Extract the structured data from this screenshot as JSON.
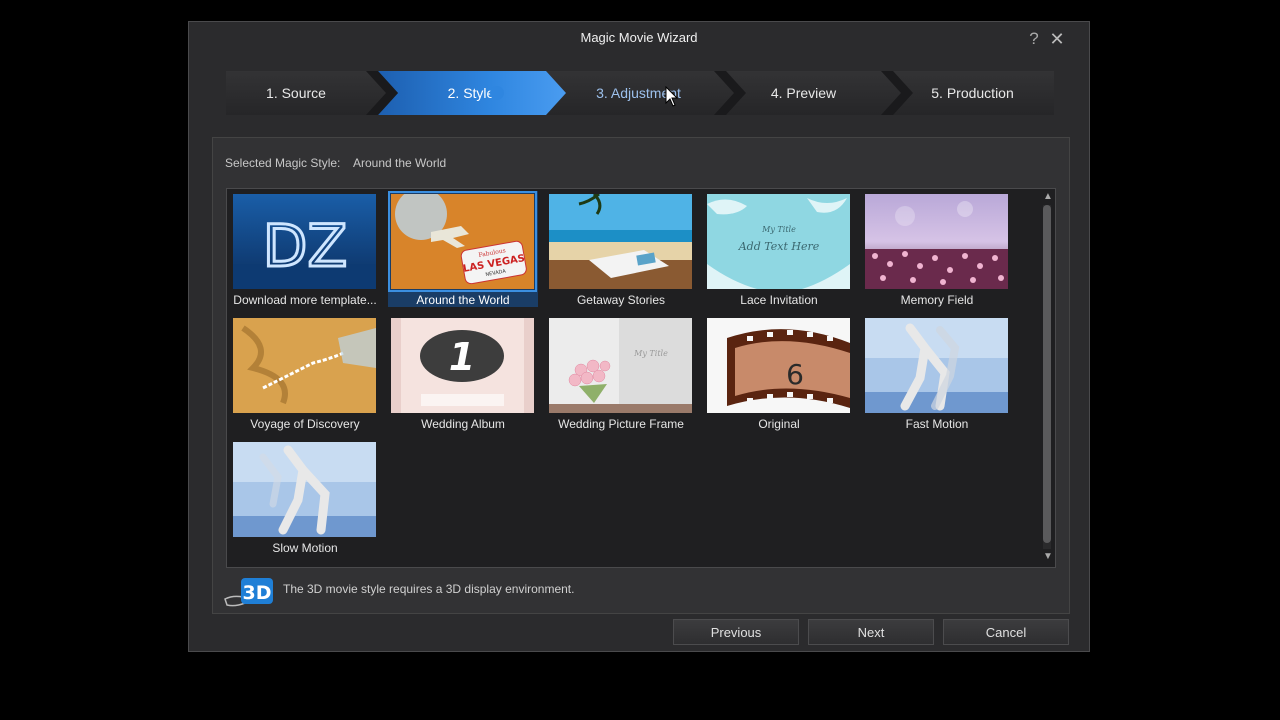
{
  "window": {
    "title": "Magic Movie Wizard",
    "help_label": "?",
    "close_label": "✕"
  },
  "steps": [
    {
      "label": "1. Source",
      "state": "done"
    },
    {
      "label": "2. Style",
      "state": "active"
    },
    {
      "label": "3. Adjustment",
      "state": "hover"
    },
    {
      "label": "4. Preview",
      "state": "pending"
    },
    {
      "label": "5. Production",
      "state": "pending"
    }
  ],
  "style_panel": {
    "selected_label": "Selected Magic Style:",
    "selected_value": "Around the World",
    "styles": [
      {
        "name": "Download more template...",
        "selected": false
      },
      {
        "name": "Around the World",
        "selected": true
      },
      {
        "name": "Getaway Stories",
        "selected": false
      },
      {
        "name": "Lace Invitation",
        "selected": false
      },
      {
        "name": "Memory Field",
        "selected": false
      },
      {
        "name": "Voyage of Discovery",
        "selected": false
      },
      {
        "name": "Wedding Album",
        "selected": false
      },
      {
        "name": "Wedding Picture Frame",
        "selected": false
      },
      {
        "name": "Original",
        "selected": false
      },
      {
        "name": "Fast Motion",
        "selected": false
      },
      {
        "name": "Slow Motion",
        "selected": false
      }
    ],
    "thumb_text": {
      "dz_logo": "DZ",
      "vegas_line1": "Fabulous",
      "vegas_line2": "LAS VEGAS",
      "vegas_line3": "NEVADA",
      "lace_title": "My Title",
      "lace_text": "Add Text Here",
      "album_number": "1",
      "frame_title": "My Title",
      "film_number": "6"
    }
  },
  "notice": {
    "badge": "3D",
    "text": "The 3D movie style requires a 3D display environment."
  },
  "buttons": {
    "previous": "Previous",
    "next": "Next",
    "cancel": "Cancel"
  },
  "colors": {
    "accent": "#2f86e0",
    "selected_outline": "#3b8fe0",
    "background": "#2b2b2d"
  }
}
